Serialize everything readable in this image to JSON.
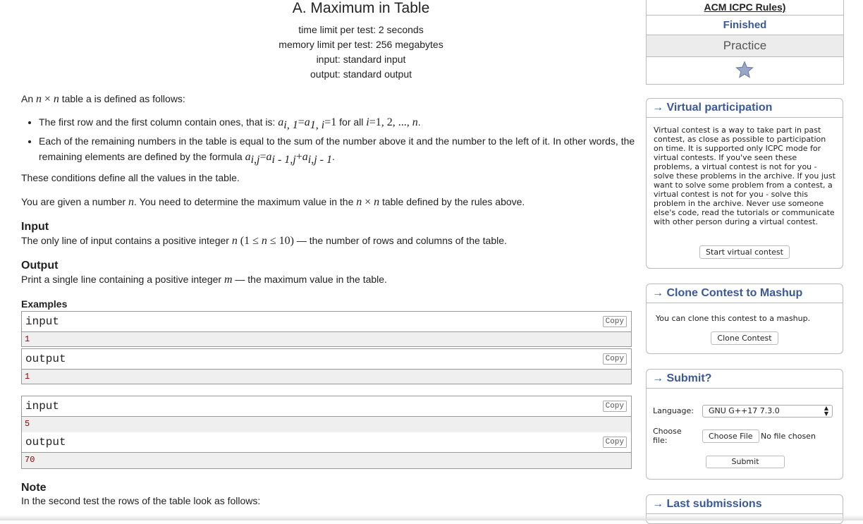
{
  "problem": {
    "title": "A. Maximum in Table",
    "time_limit": "time limit per test: 2 seconds",
    "memory_limit": "memory limit per test: 256 megabytes",
    "input_file": "input: standard input",
    "output_file": "output: standard output",
    "intro": "table a is defined as follows:",
    "rule1_text": "The first row and the first column contain ones, that is:",
    "rule1_tail": "for all",
    "rule2_text": "Each of the remaining numbers in the table is equal to the sum of the number above it and the number to the left of it. In other words, the remaining elements are defined by the formula",
    "conditions": "These conditions define all the values in the table.",
    "task_pre": "You are given a number",
    "task_mid": ". You need to determine the maximum value in the",
    "task_post": "table defined by the rules above.",
    "input_title": "Input",
    "input_pre": "The only line of input contains a positive integer",
    "input_post": "— the number of rows and columns of the table.",
    "output_title": "Output",
    "output_pre": "Print a single line containing a positive integer",
    "output_post": "— the maximum value in the table.",
    "examples_title": "Examples",
    "examples": [
      {
        "input_label": "input",
        "input": "1",
        "output_label": "output",
        "output": "1"
      },
      {
        "input_label": "input",
        "input": "5",
        "output_label": "output",
        "output": "70"
      }
    ],
    "copy_label": "Copy",
    "note_title": "Note",
    "note_text": "In the second test the rows of the table look as follows:"
  },
  "sidebar": {
    "rules_link": "ACM ICPC Rules)",
    "status": "Finished",
    "mode": "Practice",
    "virtual": {
      "title": "→ Virtual participation",
      "text": "Virtual contest is a way to take part in past contest, as close as possible to participation on time. It is supported only ICPC mode for virtual contests. If you've seen these problems, a virtual contest is not for you - solve these problems in the archive. If you just want to solve some problem from a contest, a virtual contest is not for you - solve this problem in the archive. Never use someone else's code, read the tutorials or communicate with other person during a virtual contest.",
      "button": "Start virtual contest"
    },
    "clone": {
      "title": "→ Clone Contest to Mashup",
      "text": "You can clone this contest to a mashup.",
      "button": "Clone Contest"
    },
    "submit": {
      "title": "→ Submit?",
      "language_label": "Language:",
      "language_value": "GNU G++17 7.3.0",
      "file_label": "Choose file:",
      "file_button": "Choose File",
      "file_value": "No file chosen",
      "submit_button": "Submit"
    },
    "last": {
      "title": "→ Last submissions"
    }
  },
  "colors": {
    "link": "#3b5998",
    "data_text": "#8b0000",
    "data_bg": "#efefef"
  }
}
